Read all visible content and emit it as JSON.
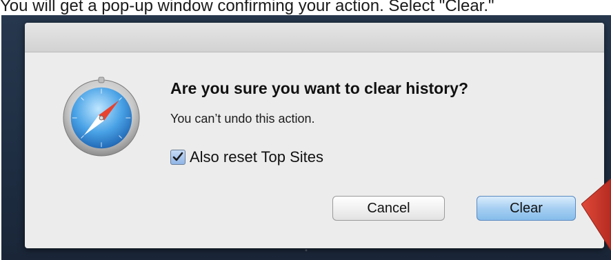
{
  "caption": "You will get a pop-up window confirming your action. Select \"Clear.\"",
  "dialog": {
    "title": "Are you sure you want to clear history?",
    "message": "You can’t undo this action.",
    "checkbox": {
      "label": "Also reset Top Sites",
      "checked": true
    },
    "buttons": {
      "cancel": "Cancel",
      "clear": "Clear"
    },
    "icon": "safari-compass-icon"
  },
  "colors": {
    "background": "#1f2f44",
    "dialog": "#ececec",
    "default_button": "#a6cff2",
    "arrow": "#d33a2c"
  }
}
